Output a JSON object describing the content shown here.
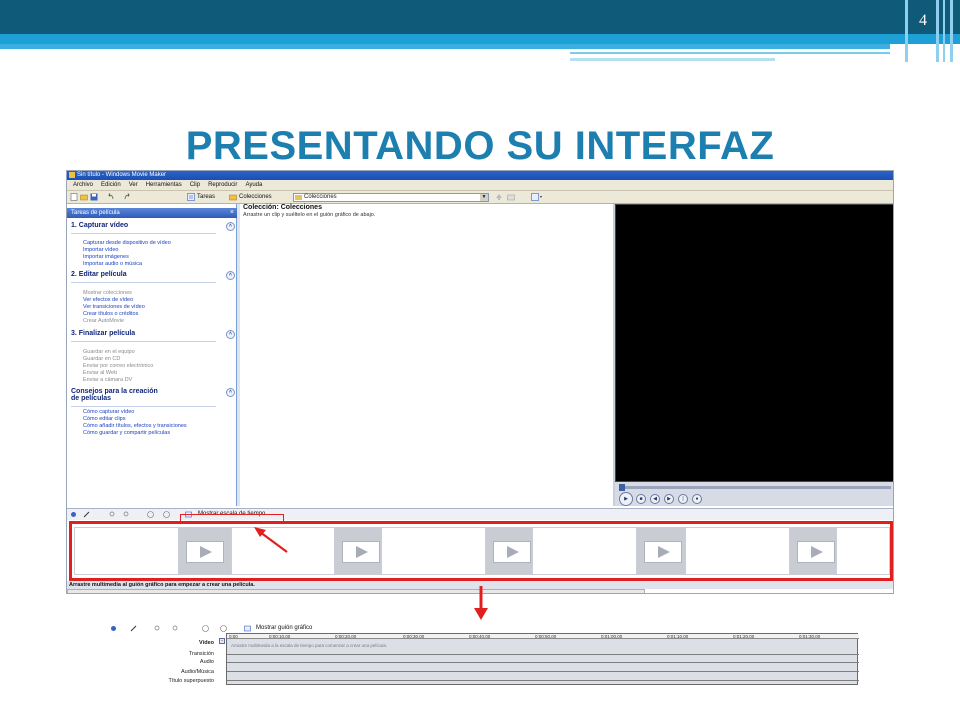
{
  "slide": {
    "page_number": "4",
    "title": "PRESENTANDO SU INTERFAZ"
  },
  "window": {
    "title": "Sin título - Windows Movie Maker",
    "menu": [
      "Archivo",
      "Edición",
      "Ver",
      "Herramientas",
      "Clip",
      "Reproducir",
      "Ayuda"
    ],
    "toolbar": {
      "tasks_label": "Tareas",
      "collections_label": "Colecciones",
      "combo_value": "Colecciones"
    }
  },
  "task_pane": {
    "header": "Tareas de película",
    "close": "×",
    "sections": [
      {
        "title": "1. Capturar vídeo",
        "links": [
          "Capturar desde dispositivo de vídeo",
          "Importar vídeo",
          "Importar imágenes",
          "Importar audio o música"
        ]
      },
      {
        "title": "2. Editar película",
        "links": [
          "Mostrar colecciones",
          "Ver efectos de vídeo",
          "Ver transiciones de vídeo",
          "Crear títulos o créditos",
          "Crear AutoMovie"
        ]
      },
      {
        "title": "3. Finalizar película",
        "links": [
          "Guardar en el equipo",
          "Guardar en CD",
          "Enviar por correo electrónico",
          "Enviar al Web",
          "Enviar a cámara DV"
        ]
      },
      {
        "title_line1": "Consejos para la creación",
        "title_line2": "de películas",
        "links": [
          "Cómo capturar vídeo",
          "Cómo editar clips",
          "Cómo añadir títulos, efectos y transiciones",
          "Cómo guardar y compartir películas"
        ]
      }
    ]
  },
  "collection": {
    "title": "Colección: Colecciones",
    "subtitle": "Arrastre un clip y suéltelo en el guión gráfico de abajo."
  },
  "storyboard": {
    "toggle_label": "Mostrar escala de tiempo",
    "status": "Arrastre multimedia al guión gráfico para empezar a crear una película."
  },
  "timeline": {
    "toggle_label": "Mostrar guión gráfico",
    "ticks": [
      "0:00",
      "0:00:10,00",
      "0:00:20,00",
      "0:00:30,00",
      "0:00:40,00",
      "0:00:50,00",
      "0:01:00,00",
      "0:01:10,00",
      "0:01:20,00",
      "0:01:30,00"
    ],
    "tracks": [
      "Vídeo",
      "Transición",
      "Audio",
      "Audio/Música",
      "Título superpuesto"
    ],
    "video_hint": "Arrastre multimedia a la escala de tiempo para comenzar a crear una película."
  },
  "colors": {
    "header_dark": "#0e5a78",
    "header_light": "#1e9fd6",
    "title": "#1c7fb0",
    "highlight": "#e02020"
  }
}
